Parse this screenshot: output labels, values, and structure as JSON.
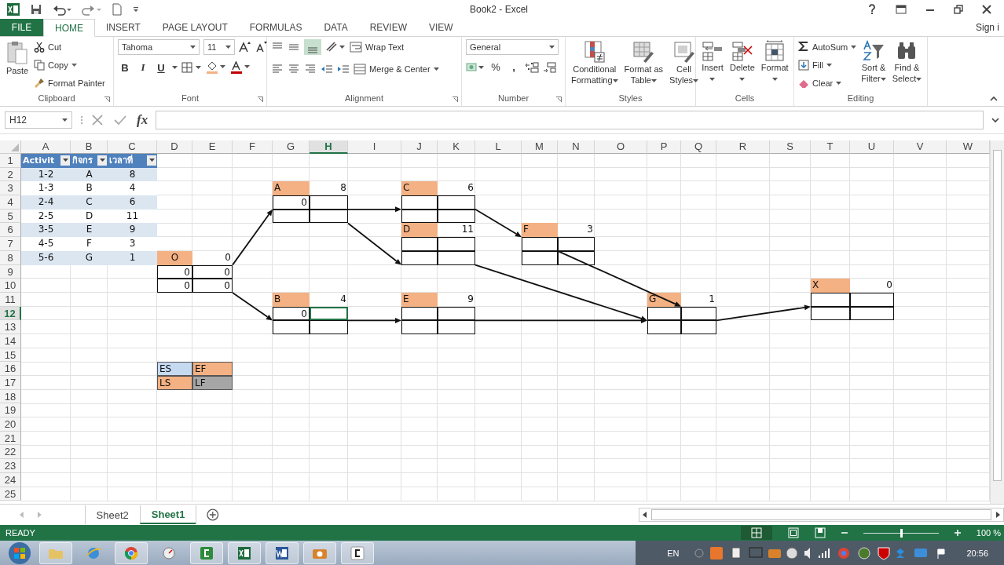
{
  "window": {
    "title": "Book2 - Excel",
    "account": "Sign i"
  },
  "tabs": [
    {
      "label": "FILE",
      "kind": "file",
      "selected": false
    },
    {
      "label": "HOME",
      "kind": "tab",
      "selected": true
    },
    {
      "label": "INSERT",
      "kind": "tab",
      "selected": false
    },
    {
      "label": "PAGE LAYOUT",
      "kind": "tab",
      "selected": false
    },
    {
      "label": "FORMULAS",
      "kind": "tab",
      "selected": false
    },
    {
      "label": "DATA",
      "kind": "tab",
      "selected": false
    },
    {
      "label": "REVIEW",
      "kind": "tab",
      "selected": false
    },
    {
      "label": "VIEW",
      "kind": "tab",
      "selected": false
    }
  ],
  "ribbon": {
    "clipboard": {
      "title": "Clipboard",
      "paste": "Paste",
      "cut": "Cut",
      "copy": "Copy",
      "format_painter": "Format Painter"
    },
    "font": {
      "title": "Font",
      "family": "Tahoma",
      "size": "11",
      "bold": "B",
      "italic": "I",
      "underline": "U"
    },
    "alignment": {
      "title": "Alignment",
      "wrap_text": "Wrap Text",
      "merge_center": "Merge & Center"
    },
    "number": {
      "title": "Number",
      "format": "General",
      "percent": "%",
      "comma": ","
    },
    "styles": {
      "title": "Styles",
      "buttons": [
        [
          "Conditional",
          "Formatting"
        ],
        [
          "Format as",
          "Table"
        ],
        [
          "Cell",
          "Styles"
        ]
      ]
    },
    "cells": {
      "title": "Cells",
      "buttons": [
        "Insert",
        "Delete",
        "Format"
      ]
    },
    "editing": {
      "title": "Editing",
      "autosum": "AutoSum",
      "fill": "Fill",
      "clear": "Clear",
      "sort_filter": [
        "Sort &",
        "Filter"
      ],
      "find_select": [
        "Find &",
        "Select"
      ]
    }
  },
  "formula_bar": {
    "name_box": "H12",
    "function_label": "fx"
  },
  "sheet": {
    "columns": [
      {
        "label": "A",
        "selected": false
      },
      {
        "label": "B",
        "selected": false
      },
      {
        "label": "C",
        "selected": false
      },
      {
        "label": "D",
        "selected": false
      },
      {
        "label": "E",
        "selected": false
      },
      {
        "label": "F",
        "selected": false
      },
      {
        "label": "G",
        "selected": false
      },
      {
        "label": "H",
        "selected": true
      },
      {
        "label": "I",
        "selected": false
      },
      {
        "label": "J",
        "selected": false
      },
      {
        "label": "K",
        "selected": false
      },
      {
        "label": "L",
        "selected": false
      },
      {
        "label": "M",
        "selected": false
      },
      {
        "label": "N",
        "selected": false
      },
      {
        "label": "O",
        "selected": false
      },
      {
        "label": "P",
        "selected": false
      },
      {
        "label": "Q",
        "selected": false
      },
      {
        "label": "R",
        "selected": false
      },
      {
        "label": "S",
        "selected": false
      },
      {
        "label": "T",
        "selected": false
      },
      {
        "label": "U",
        "selected": false
      },
      {
        "label": "V",
        "selected": false
      },
      {
        "label": "W",
        "selected": false
      }
    ],
    "rows": [
      {
        "label": "1",
        "selected": false,
        "cells": [
          {
            "text": "Activit",
            "kind": "header",
            "selected": false
          },
          {
            "text": "กิจกร",
            "kind": "header",
            "selected": false
          },
          {
            "text": "เวลาที่",
            "kind": "header",
            "selected": false
          }
        ]
      },
      {
        "label": "2",
        "selected": false,
        "cells": [
          {
            "text": "1-2",
            "kind": "band",
            "selected": false
          },
          {
            "text": "A",
            "kind": "band",
            "selected": false
          },
          {
            "text": "8",
            "kind": "band",
            "selected": false
          }
        ]
      },
      {
        "label": "3",
        "selected": false,
        "cells": [
          {
            "text": "1-3",
            "kind": "plain",
            "selected": false
          },
          {
            "text": "B",
            "kind": "plain",
            "selected": false
          },
          {
            "text": "4",
            "kind": "plain",
            "selected": false
          },
          null,
          null,
          null,
          {
            "text": "A",
            "kind": "node-title",
            "selected": false
          },
          {
            "text": "8",
            "kind": "duration",
            "selected": false
          },
          null,
          {
            "text": "C",
            "kind": "node-title",
            "selected": false
          },
          {
            "text": "6",
            "kind": "duration",
            "selected": false
          }
        ]
      },
      {
        "label": "4",
        "selected": false,
        "cells": [
          {
            "text": "2-4",
            "kind": "band",
            "selected": false
          },
          {
            "text": "C",
            "kind": "band",
            "selected": false
          },
          {
            "text": "6",
            "kind": "band",
            "selected": false
          },
          null,
          null,
          null,
          {
            "text": "0",
            "kind": "node-cell",
            "selected": false
          },
          {
            "kind": "node-cell",
            "selected": false
          },
          null,
          {
            "kind": "node-cell",
            "selected": false
          },
          {
            "kind": "node-cell",
            "selected": false
          }
        ]
      },
      {
        "label": "5",
        "selected": false,
        "cells": [
          {
            "text": "2-5",
            "kind": "plain",
            "selected": false
          },
          {
            "text": "D",
            "kind": "plain",
            "selected": false
          },
          {
            "text": "11",
            "kind": "plain",
            "selected": false
          },
          null,
          null,
          null,
          {
            "kind": "node-cell",
            "selected": false
          },
          {
            "kind": "node-cell",
            "selected": false
          },
          null,
          {
            "kind": "node-cell",
            "selected": false
          },
          {
            "kind": "node-cell",
            "selected": false
          }
        ]
      },
      {
        "label": "6",
        "selected": false,
        "cells": [
          {
            "text": "3-5",
            "kind": "band",
            "selected": false
          },
          {
            "text": "E",
            "kind": "band",
            "selected": false
          },
          {
            "text": "9",
            "kind": "band",
            "selected": false
          },
          null,
          null,
          null,
          null,
          null,
          null,
          {
            "text": "D",
            "kind": "node-title",
            "selected": false
          },
          {
            "text": "11",
            "kind": "duration",
            "selected": false
          },
          null,
          {
            "text": "F",
            "kind": "node-title",
            "selected": false
          },
          {
            "text": "3",
            "kind": "duration",
            "selected": false
          }
        ]
      },
      {
        "label": "7",
        "selected": false,
        "cells": [
          {
            "text": "4-5",
            "kind": "plain",
            "selected": false
          },
          {
            "text": "F",
            "kind": "plain",
            "selected": false
          },
          {
            "text": "3",
            "kind": "plain",
            "selected": false
          },
          null,
          null,
          null,
          null,
          null,
          null,
          {
            "kind": "node-cell",
            "selected": false
          },
          {
            "kind": "node-cell",
            "selected": false
          },
          null,
          {
            "kind": "node-cell",
            "selected": false
          },
          {
            "kind": "node-cell",
            "selected": false
          }
        ]
      },
      {
        "label": "8",
        "selected": false,
        "cells": [
          {
            "text": "5-6",
            "kind": "band",
            "selected": false
          },
          {
            "text": "G",
            "kind": "band",
            "selected": false
          },
          {
            "text": "1",
            "kind": "band",
            "selected": false
          },
          {
            "text": "O",
            "kind": "start-title",
            "selected": false
          },
          {
            "text": "0",
            "kind": "duration",
            "selected": false
          },
          null,
          null,
          null,
          null,
          {
            "kind": "node-cell",
            "selected": false
          },
          {
            "kind": "node-cell",
            "selected": false
          },
          null,
          {
            "kind": "node-cell",
            "selected": false
          },
          {
            "kind": "node-cell",
            "selected": false
          }
        ]
      },
      {
        "label": "9",
        "selected": false,
        "cells": [
          null,
          null,
          null,
          {
            "text": "0",
            "kind": "node-cell",
            "selected": false
          },
          {
            "text": "0",
            "kind": "node-cell",
            "selected": false
          }
        ]
      },
      {
        "label": "10",
        "selected": false,
        "cells": [
          null,
          null,
          null,
          {
            "text": "0",
            "kind": "node-cell",
            "selected": false
          },
          {
            "text": "0",
            "kind": "node-cell",
            "selected": false
          },
          null,
          null,
          null,
          null,
          null,
          null,
          null,
          null,
          null,
          null,
          null,
          null,
          null,
          null,
          {
            "text": "X",
            "kind": "node-title",
            "selected": false
          },
          {
            "text": "0",
            "kind": "duration",
            "selected": false
          }
        ]
      },
      {
        "label": "11",
        "selected": false,
        "cells": [
          null,
          null,
          null,
          null,
          null,
          null,
          {
            "text": "B",
            "kind": "node-title",
            "selected": false
          },
          {
            "text": "4",
            "kind": "duration",
            "selected": false
          },
          null,
          {
            "text": "E",
            "kind": "node-title",
            "selected": false
          },
          {
            "text": "9",
            "kind": "duration",
            "selected": false
          },
          null,
          null,
          null,
          null,
          {
            "text": "G",
            "kind": "node-title",
            "selected": false
          },
          {
            "text": "1",
            "kind": "duration",
            "selected": false
          },
          null,
          null,
          {
            "kind": "node-cell",
            "selected": false
          },
          {
            "kind": "node-cell",
            "selected": false
          }
        ]
      },
      {
        "label": "12",
        "selected": true,
        "cells": [
          null,
          null,
          null,
          null,
          null,
          null,
          {
            "text": "0",
            "kind": "node-cell",
            "selected": false
          },
          {
            "kind": "node-cell",
            "selected": true
          },
          null,
          {
            "kind": "node-cell",
            "selected": false
          },
          {
            "kind": "node-cell",
            "selected": false
          },
          null,
          null,
          null,
          null,
          {
            "kind": "node-cell",
            "selected": false
          },
          {
            "kind": "node-cell",
            "selected": false
          },
          null,
          null,
          {
            "kind": "node-cell",
            "selected": false
          },
          {
            "kind": "node-cell",
            "selected": false
          }
        ]
      },
      {
        "label": "13",
        "selected": false,
        "cells": [
          null,
          null,
          null,
          null,
          null,
          null,
          {
            "kind": "node-cell",
            "selected": false
          },
          {
            "kind": "node-cell",
            "selected": false
          },
          null,
          {
            "kind": "node-cell",
            "selected": false
          },
          {
            "kind": "node-cell",
            "selected": false
          },
          null,
          null,
          null,
          null,
          {
            "kind": "node-cell",
            "selected": false
          },
          {
            "kind": "node-cell",
            "selected": false
          }
        ]
      },
      {
        "label": "14",
        "selected": false
      },
      {
        "label": "15",
        "selected": false
      },
      {
        "label": "16",
        "selected": false,
        "cells": [
          null,
          null,
          null,
          {
            "text": "ES",
            "kind": "legend",
            "color": "#c5d9f1",
            "selected": false
          },
          {
            "text": "EF",
            "kind": "legend",
            "color": "#f4b183",
            "selected": false
          }
        ]
      },
      {
        "label": "17",
        "selected": false,
        "cells": [
          null,
          null,
          null,
          {
            "text": "LS",
            "kind": "legend",
            "color": "#f4b183",
            "selected": false
          },
          {
            "text": "LF",
            "kind": "legend",
            "color": "#a6a6a6",
            "selected": false
          }
        ]
      },
      {
        "label": "18",
        "selected": false
      },
      {
        "label": "19",
        "selected": false
      },
      {
        "label": "20",
        "selected": false
      },
      {
        "label": "21",
        "selected": false
      },
      {
        "label": "22",
        "selected": false
      },
      {
        "label": "23",
        "selected": false
      },
      {
        "label": "24",
        "selected": false
      },
      {
        "label": "25",
        "selected": false
      }
    ]
  },
  "sheet_tabs": [
    {
      "label": "Sheet2",
      "selected": false
    },
    {
      "label": "Sheet1",
      "selected": true
    }
  ],
  "status_bar": {
    "mode": "READY",
    "zoom": "100 %",
    "zoom_slider": {
      "level": 0.5
    }
  },
  "taskbar": {
    "language": "EN",
    "clock": "20:56"
  }
}
